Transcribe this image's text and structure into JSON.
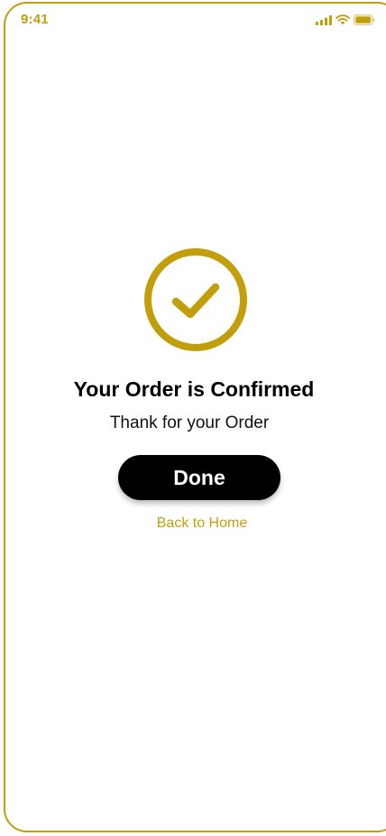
{
  "status_bar": {
    "time": "9:41",
    "icons": [
      "signal-icon",
      "wifi-icon",
      "battery-icon"
    ]
  },
  "confirmation": {
    "icon": "check-circle-icon",
    "title": "Your Order is Confirmed",
    "subtitle": "Thank for your Order"
  },
  "actions": {
    "done_label": "Done",
    "back_label": "Back to Home"
  },
  "colors": {
    "accent": "#C29E0B",
    "button_bg": "#000000",
    "button_text": "#FFFFFF",
    "text": "#000000"
  }
}
